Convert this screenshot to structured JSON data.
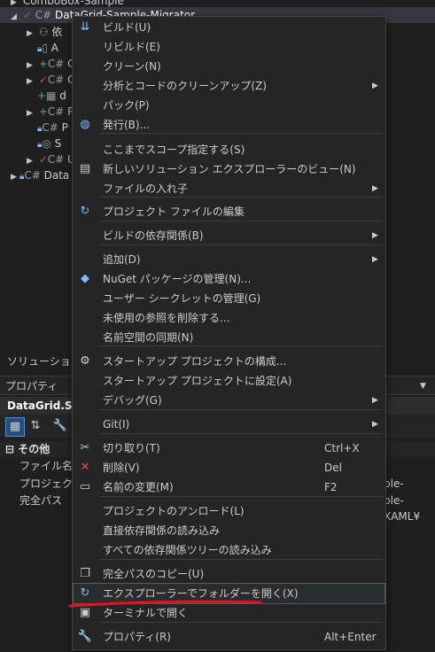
{
  "tree": {
    "top_item": "ComboBox-Sample",
    "selected_item": "DataGrid-Sample-Migrator",
    "items": [
      {
        "prefix": "",
        "text": "A"
      },
      {
        "prefix": "C#",
        "text": "C"
      },
      {
        "prefix": "C#",
        "text": "C"
      },
      {
        "prefix": "",
        "text": "d"
      },
      {
        "prefix": "C#",
        "text": "P"
      },
      {
        "prefix": "C#",
        "text": "P"
      },
      {
        "prefix": "",
        "text": "S"
      },
      {
        "prefix": "C#",
        "text": "U"
      }
    ],
    "bottom_item": "Data"
  },
  "panels": {
    "solution_tab": "ソリューション エ",
    "properties_title": "プロパティ",
    "object_name": "DataGrid.Samp",
    "category": "その他",
    "rows": [
      {
        "name": "ファイル名",
        "value": ""
      },
      {
        "name": "プロジェクト フ",
        "value": "ple-XAML¥"
      },
      {
        "name": "完全パス",
        "value": "ple-XAML¥"
      }
    ]
  },
  "menu": {
    "items": [
      {
        "icon": "build-icon",
        "glyph": "⇊",
        "label": "ビルド(U)"
      },
      {
        "icon": "",
        "glyph": "",
        "label": "リビルド(E)"
      },
      {
        "icon": "",
        "glyph": "",
        "label": "クリーン(N)"
      },
      {
        "icon": "",
        "glyph": "",
        "label": "分析とコードのクリーンアップ(Z)",
        "submenu": true
      },
      {
        "icon": "",
        "glyph": "",
        "label": "パック(P)"
      },
      {
        "icon": "globe-icon",
        "glyph": "◍",
        "label": "発行(B)..."
      },
      {
        "icon": "",
        "glyph": "",
        "label": "ここまでスコープ指定する(S)"
      },
      {
        "icon": "new-explorer-view-icon",
        "glyph": "▤",
        "label": "新しいソリューション エクスプローラーのビュー(N)"
      },
      {
        "icon": "",
        "glyph": "",
        "label": "ファイルの入れ子",
        "submenu": true
      },
      {
        "icon": "edit-project-icon",
        "glyph": "↻",
        "label": "プロジェクト ファイルの編集"
      },
      {
        "icon": "",
        "glyph": "",
        "label": "ビルドの依存関係(B)",
        "submenu": true
      },
      {
        "icon": "",
        "glyph": "",
        "label": "追加(D)",
        "submenu": true
      },
      {
        "icon": "nuget-icon",
        "glyph": "◆",
        "label": "NuGet パッケージの管理(N)..."
      },
      {
        "icon": "",
        "glyph": "",
        "label": "ユーザー シークレットの管理(G)"
      },
      {
        "icon": "",
        "glyph": "",
        "label": "未使用の参照を削除する..."
      },
      {
        "icon": "",
        "glyph": "",
        "label": "名前空間の同期(N)"
      },
      {
        "icon": "gear-icon",
        "glyph": "⚙",
        "label": "スタートアップ プロジェクトの構成..."
      },
      {
        "icon": "",
        "glyph": "",
        "label": "スタートアップ プロジェクトに設定(A)"
      },
      {
        "icon": "",
        "glyph": "",
        "label": "デバッグ(G)",
        "submenu": true
      },
      {
        "icon": "",
        "glyph": "",
        "label": "Git(I)",
        "submenu": true
      },
      {
        "icon": "scissors-icon",
        "glyph": "✂",
        "label": "切り取り(T)",
        "shortcut": "Ctrl+X"
      },
      {
        "icon": "delete-icon",
        "glyph": "✕",
        "label": "削除(V)",
        "shortcut": "Del"
      },
      {
        "icon": "rename-icon",
        "glyph": "▭",
        "label": "名前の変更(M)",
        "shortcut": "F2"
      },
      {
        "icon": "",
        "glyph": "",
        "label": "プロジェクトのアンロード(L)"
      },
      {
        "icon": "",
        "glyph": "",
        "label": "直接依存関係の読み込み"
      },
      {
        "icon": "",
        "glyph": "",
        "label": "すべての依存関係ツリーの読み込み"
      },
      {
        "icon": "copy-icon",
        "glyph": "❐",
        "label": "完全パスのコピー(U)"
      },
      {
        "icon": "open-folder-icon",
        "glyph": "↻",
        "label": "エクスプローラーでフォルダーを開く(X)"
      },
      {
        "icon": "terminal-icon",
        "glyph": "▣",
        "label": "ターミナルで開く"
      },
      {
        "icon": "wrench-icon",
        "glyph": "🔧",
        "label": "プロパティ(R)",
        "shortcut": "Alt+Enter"
      }
    ]
  },
  "colors": {
    "annotation_underline": "#e81123",
    "delete_icon": "#e05252",
    "accent_icon": "#75beff"
  }
}
